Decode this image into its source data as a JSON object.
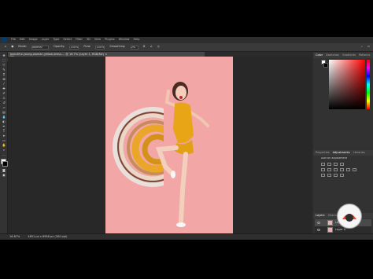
{
  "app": {
    "menu": [
      "File",
      "Edit",
      "Image",
      "Layer",
      "Type",
      "Select",
      "Filter",
      "3D",
      "View",
      "Plugins",
      "Window",
      "Help"
    ],
    "options": {
      "mode_label": "Mode:",
      "mode_value": "Normal",
      "opacity_label": "Opacity:",
      "opacity_value": "100%",
      "flow_label": "Flow:",
      "flow_value": "100%",
      "smoothing_label": "Smoothing:",
      "smoothing_value": "0%"
    },
    "document_tab": "beautiful-young-woman-yellow-dress-... @ 16.7% (Layer 1, RGB/8#) ×",
    "status": {
      "zoom": "16.67%",
      "doc_info": "4851 px x 6958 px (300 ppi)"
    }
  },
  "panels": {
    "color_tabs": [
      "Color",
      "Swatches",
      "Gradients",
      "Patterns"
    ],
    "properties_tabs": [
      "Properties",
      "Adjustments",
      "Libraries"
    ],
    "adjustments_label": "Add an adjustment",
    "layers_tabs": [
      "Layers",
      "Channels",
      "Paths"
    ],
    "layers": [
      {
        "name": "Layer 1",
        "selected": true
      },
      {
        "name": "Layer 0",
        "selected": false
      },
      {
        "name": "Background",
        "selected": false
      }
    ]
  },
  "colors": {
    "photo_background": "#f2a6a6",
    "dress": "#e8a516",
    "accent_blue": "#0a3a66"
  }
}
